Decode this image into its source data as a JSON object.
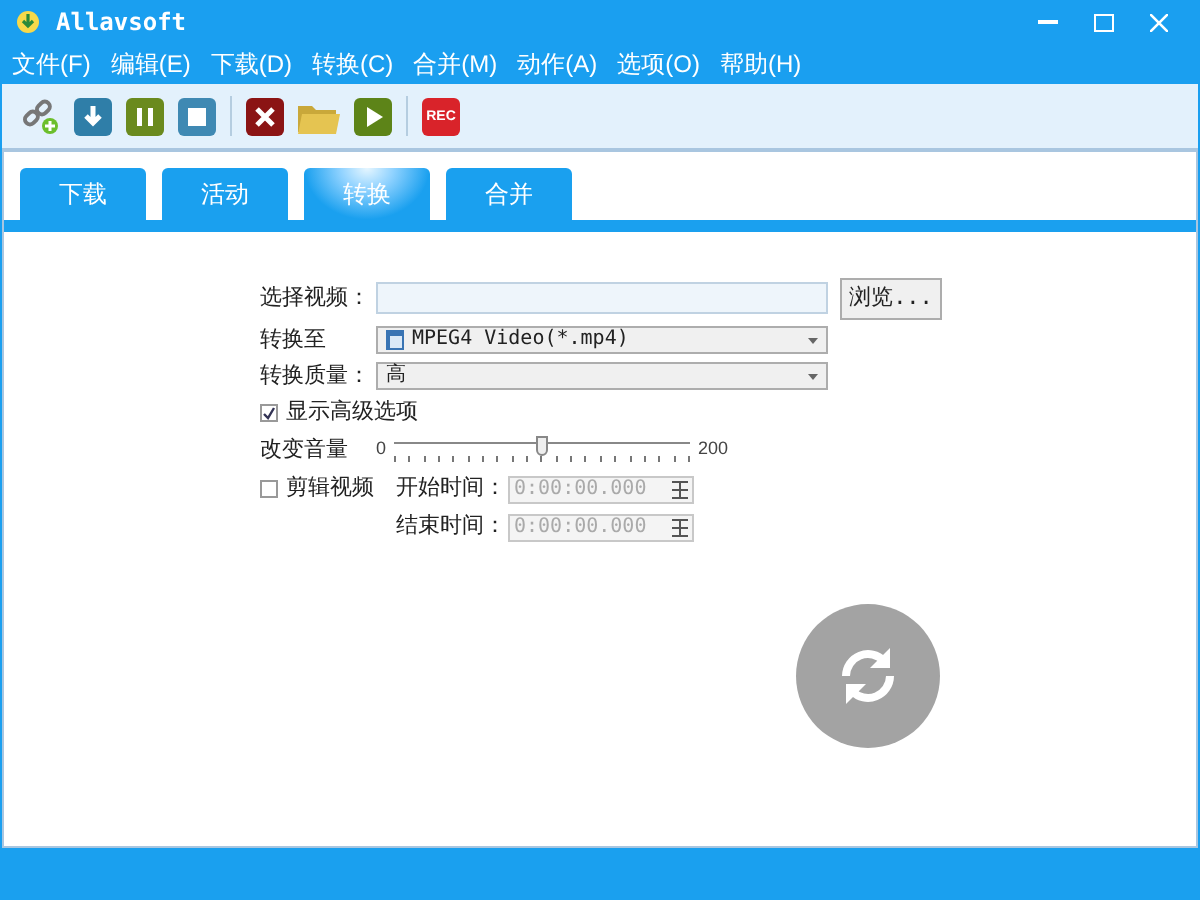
{
  "window": {
    "title": "Allavsoft"
  },
  "menu": [
    "文件(F)",
    "编辑(E)",
    "下载(D)",
    "转换(C)",
    "合并(M)",
    "动作(A)",
    "选项(O)",
    "帮助(H)"
  ],
  "toolbar": [
    {
      "kind": "link"
    },
    {
      "kind": "download"
    },
    {
      "kind": "pause"
    },
    {
      "kind": "stop"
    },
    {
      "kind": "sep"
    },
    {
      "kind": "delete"
    },
    {
      "kind": "folder"
    },
    {
      "kind": "play"
    },
    {
      "kind": "sep"
    },
    {
      "kind": "rec",
      "label": "REC"
    }
  ],
  "tabs": [
    {
      "label": "下载",
      "selected": false
    },
    {
      "label": "活动",
      "selected": false
    },
    {
      "label": "转换",
      "selected": true
    },
    {
      "label": "合并",
      "selected": false
    }
  ],
  "form": {
    "video_label": "选择视频：",
    "browse": "浏览...",
    "convert_to_label": "转换至",
    "convert_to_value": "MPEG4 Video(*.mp4)",
    "quality_label": "转换质量：",
    "quality_value": "高",
    "advanced": {
      "label": "显示高级选项",
      "checked": true
    },
    "volume": {
      "label": "改变音量",
      "min": "0",
      "max": "200",
      "level": 0.5
    },
    "trim": {
      "label": "剪辑视频",
      "checked": false
    },
    "start": {
      "label": "开始时间：",
      "value": "0:00:00.000",
      "disabled": true
    },
    "end": {
      "label": "结束时间：",
      "value": "0:00:00.000",
      "disabled": true
    }
  }
}
